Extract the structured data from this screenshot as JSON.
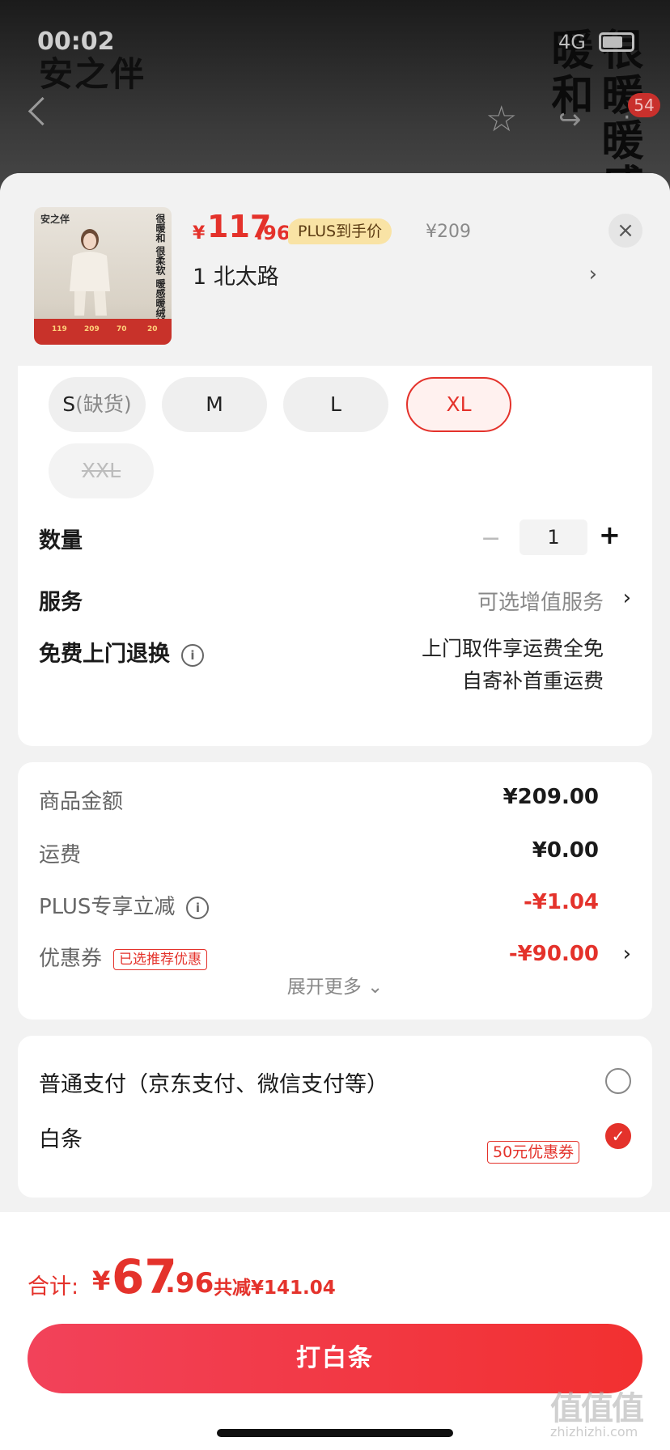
{
  "background": {
    "time": "00:02",
    "brand": "安之伴",
    "network": "4G",
    "badge": "54",
    "banner_text": "很暖暖感暖和"
  },
  "product": {
    "thumbnail": {
      "brand": "安之伴",
      "slogan": "很暖和 很柔软 暖感暖绒绒",
      "strip_prices": [
        "119",
        "209",
        "70",
        "20"
      ]
    },
    "price_symbol": "¥",
    "price_int": "117",
    "price_dec": ".96",
    "plus_tag": "PLUS到手价",
    "original_price": "¥209",
    "address": "1 北太路"
  },
  "sizes": [
    {
      "label": "S",
      "note": "(缺货)",
      "state": "normal"
    },
    {
      "label": "M",
      "note": "",
      "state": "normal"
    },
    {
      "label": "L",
      "note": "",
      "state": "normal"
    },
    {
      "label": "XL",
      "note": "",
      "state": "selected"
    },
    {
      "label": "XXL",
      "note": "",
      "state": "disabled"
    }
  ],
  "quantity": {
    "label": "数量",
    "value": "1",
    "minus": "−",
    "plus": "+"
  },
  "service": {
    "label": "服务",
    "value": "可选增值服务"
  },
  "free_return": {
    "label": "免费上门退换",
    "line1": "上门取件享运费全免",
    "line2": "自寄补首重运费"
  },
  "fees": {
    "goods_label": "商品金额",
    "goods_value": "¥209.00",
    "shipping_label": "运费",
    "shipping_value": "¥0.00",
    "plus_label": "PLUS专享立减",
    "plus_value": "-¥1.04",
    "coupon_label": "优惠券",
    "coupon_tag": "已选推荐优惠",
    "coupon_value": "-¥90.00",
    "expand": "展开更多"
  },
  "payment": {
    "normal_label": "普通支付（京东支付、微信支付等）",
    "baitiao_label": "白条",
    "baitiao_coupon": "50元优惠券"
  },
  "total": {
    "label": "合计:",
    "symbol": "¥",
    "int": "67",
    "dec": ".96",
    "saved": "共减¥141.04"
  },
  "pay_button": "打白条",
  "watermark": {
    "main": "值值值",
    "sub": "zhizhizhi.com"
  },
  "colors": {
    "accent": "#e4322b",
    "plus_tag_bg": "#f9e3a5"
  }
}
